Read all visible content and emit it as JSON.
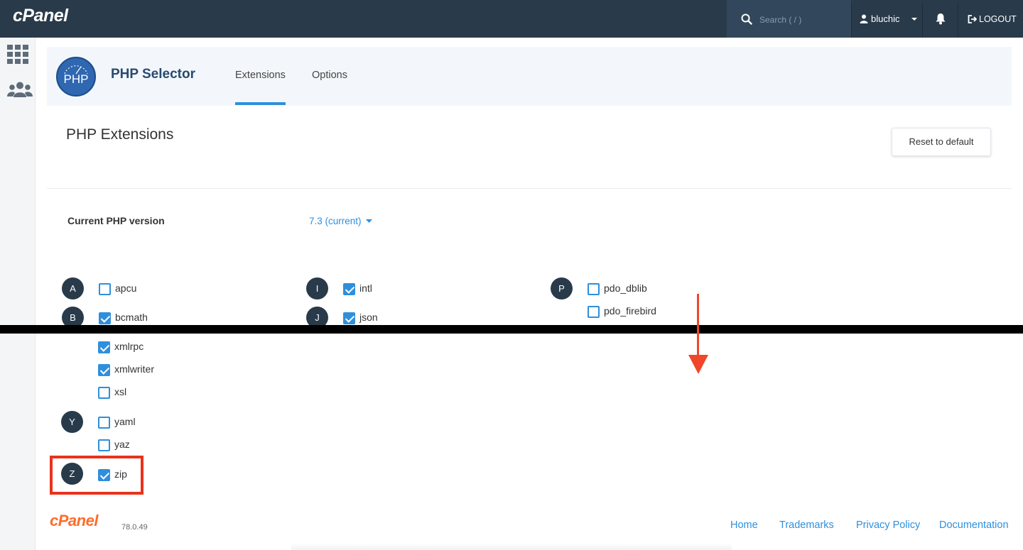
{
  "topbar": {
    "brand": "cPanel",
    "search_placeholder": "Search ( / )",
    "user": "bluchic",
    "logout": "LOGOUT"
  },
  "sidebar": {
    "icons": [
      "grid-icon",
      "users-icon"
    ]
  },
  "app": {
    "logo_text": "PHP",
    "title": "PHP Selector",
    "tabs": [
      {
        "label": "Extensions",
        "active": true
      },
      {
        "label": "Options",
        "active": false
      }
    ]
  },
  "main": {
    "section_title": "PHP Extensions",
    "reset_button": "Reset to default",
    "version_label": "Current PHP version",
    "version_value": "7.3 (current)"
  },
  "letters": [
    "A",
    "B",
    "I",
    "J",
    "P",
    "Y",
    "Z"
  ],
  "extensions": [
    {
      "name": "apcu",
      "checked": false
    },
    {
      "name": "bcmath",
      "checked": true
    },
    {
      "name": "intl",
      "checked": true
    },
    {
      "name": "json",
      "checked": true
    },
    {
      "name": "pdo_dblib",
      "checked": false
    },
    {
      "name": "pdo_firebird",
      "checked": false
    },
    {
      "name": "xmlrpc",
      "checked": true
    },
    {
      "name": "xmlwriter",
      "checked": true
    },
    {
      "name": "xsl",
      "checked": false
    },
    {
      "name": "yaml",
      "checked": false
    },
    {
      "name": "yaz",
      "checked": false
    },
    {
      "name": "zip",
      "checked": true
    }
  ],
  "footer": {
    "logo": "cPanel",
    "version": "78.0.49",
    "links": [
      "Home",
      "Trademarks",
      "Privacy Policy",
      "Documentation"
    ]
  },
  "colors": {
    "topbar": "#293a4a",
    "accent": "#2f8fdc",
    "highlight": "#e9321c",
    "arrow": "#f0462a"
  }
}
